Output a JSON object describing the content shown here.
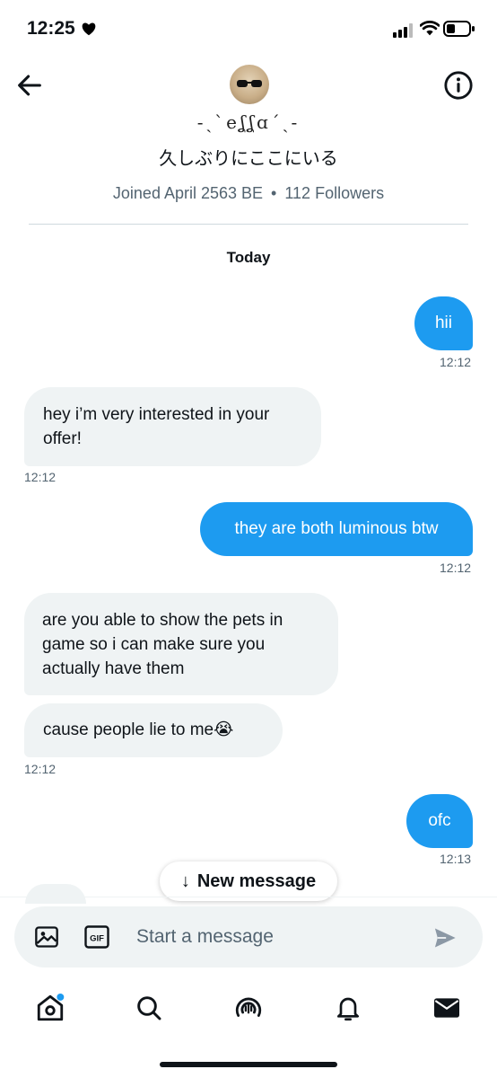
{
  "status_bar": {
    "time": "12:25",
    "heart_icon": "heart-icon",
    "signal_icon": "cellular-signal-icon",
    "wifi_icon": "wifi-icon",
    "battery_icon": "battery-icon",
    "battery_level": 0.3
  },
  "header": {
    "back_icon": "arrow-left-icon",
    "info_icon": "info-icon",
    "display_name": "-ˏˋeʆʆɑˊˎ-",
    "bio": "久しぶりにここにいる",
    "joined": "Joined April 2563 BE",
    "separator": "•",
    "followers": "112 Followers"
  },
  "conversation": {
    "date_label": "Today",
    "messages": [
      {
        "side": "sent",
        "text": "hii",
        "time": "12:12"
      },
      {
        "side": "received",
        "text": "hey i’m very interested in your offer!",
        "time": "12:12"
      },
      {
        "side": "sent",
        "text": "they are both luminous btw",
        "time": "12:12"
      },
      {
        "side": "received",
        "text": "are you able to show the pets in game so i can make sure you actually have them"
      },
      {
        "side": "received",
        "text": "cause people lie to me😭",
        "time": "12:12"
      },
      {
        "side": "sent",
        "text": "ofc",
        "time": "12:13"
      }
    ]
  },
  "new_message_pill": {
    "arrow": "↓",
    "label": "New message"
  },
  "composer": {
    "placeholder": "Start a message",
    "value": "",
    "image_icon": "image-icon",
    "gif_icon": "gif-icon",
    "gif_label": "GIF",
    "send_icon": "send-icon"
  },
  "tab_bar": {
    "items": [
      {
        "name": "home",
        "icon": "home-icon",
        "badge": true
      },
      {
        "name": "search",
        "icon": "search-icon"
      },
      {
        "name": "spaces",
        "icon": "spaces-icon"
      },
      {
        "name": "notifications",
        "icon": "bell-icon"
      },
      {
        "name": "messages",
        "icon": "mail-icon",
        "active": true
      }
    ]
  },
  "colors": {
    "accent": "#1d9bf0",
    "received_bubble": "#eff3f4",
    "text": "#0f1419",
    "secondary_text": "#536471"
  }
}
